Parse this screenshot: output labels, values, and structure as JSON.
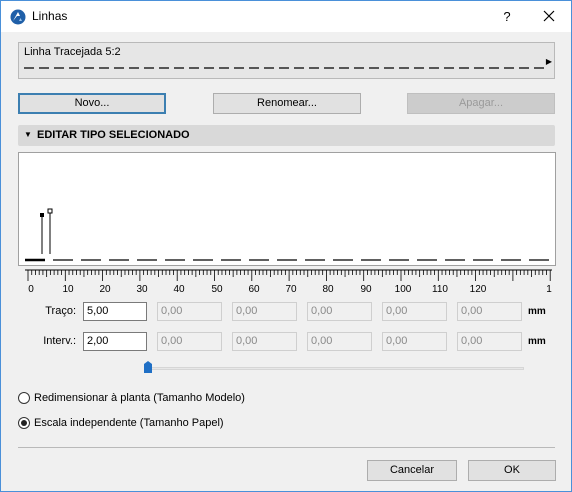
{
  "window": {
    "title": "Linhas",
    "help_label": "?"
  },
  "line_selector": {
    "selected": "Linha Tracejada 5:2"
  },
  "buttons": {
    "new": "Novo...",
    "rename": "Renomear...",
    "delete": "Apagar..."
  },
  "section": {
    "label": "EDITAR TIPO SELECIONADO"
  },
  "ruler": {
    "labels": [
      "0",
      "10",
      "20",
      "30",
      "40",
      "50",
      "60",
      "70",
      "80",
      "90",
      "100",
      "110",
      "120",
      "1"
    ]
  },
  "dash": {
    "label": "Traço:",
    "values": [
      "5,00",
      "0,00",
      "0,00",
      "0,00",
      "0,00",
      "0,00"
    ],
    "unit": "mm"
  },
  "gap": {
    "label": "Interv.:",
    "values": [
      "2,00",
      "0,00",
      "0,00",
      "0,00",
      "0,00",
      "0,00"
    ],
    "unit": "mm"
  },
  "options": {
    "model_scale": "Redimensionar à planta (Tamanho Modelo)",
    "paper_scale": "Escala independente (Tamanho Papel)",
    "selected": "paper_scale"
  },
  "footer": {
    "cancel": "Cancelar",
    "ok": "OK"
  }
}
